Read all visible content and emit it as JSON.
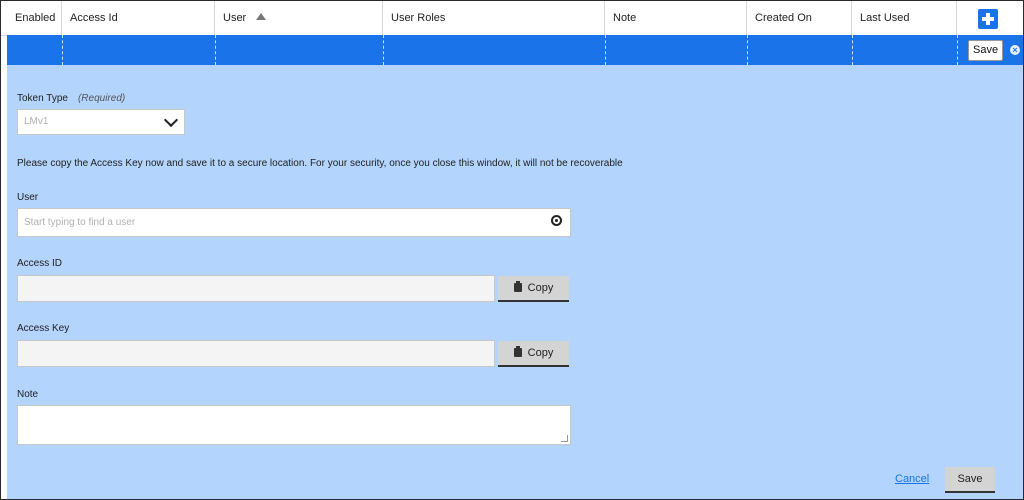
{
  "table": {
    "columns": {
      "enabled": "Enabled",
      "access_id": "Access Id",
      "user": "User",
      "user_roles": "User Roles",
      "note": "Note",
      "created_on": "Created On",
      "last_used": "Last Used"
    },
    "sort": {
      "column": "User",
      "direction": "ascending"
    },
    "row_save_label": "Save"
  },
  "form": {
    "token_type": {
      "label": "Token Type",
      "required_label": "(Required)",
      "value": "LMv1"
    },
    "notice": "Please copy the Access Key now and save it to a secure location. For your security, once you close this window, it will not be recoverable",
    "user": {
      "label": "User",
      "placeholder": "Start typing to find a user"
    },
    "access_id": {
      "label": "Access ID",
      "value": "",
      "copy_label": "Copy"
    },
    "access_key": {
      "label": "Access Key",
      "value": "",
      "copy_label": "Copy"
    },
    "note": {
      "label": "Note",
      "value": ""
    },
    "cancel_label": "Cancel",
    "save_label": "Save"
  },
  "colors": {
    "accent": "#1a73e8",
    "panel_bg": "#b3d4fc",
    "button_gray": "#d4d4d4"
  },
  "icons": {
    "add": "plus-icon",
    "sort": "sort-asc-icon",
    "close": "close-circle-icon",
    "dropdown": "chevron-down-icon",
    "search": "search-icon",
    "copy": "clipboard-icon"
  }
}
